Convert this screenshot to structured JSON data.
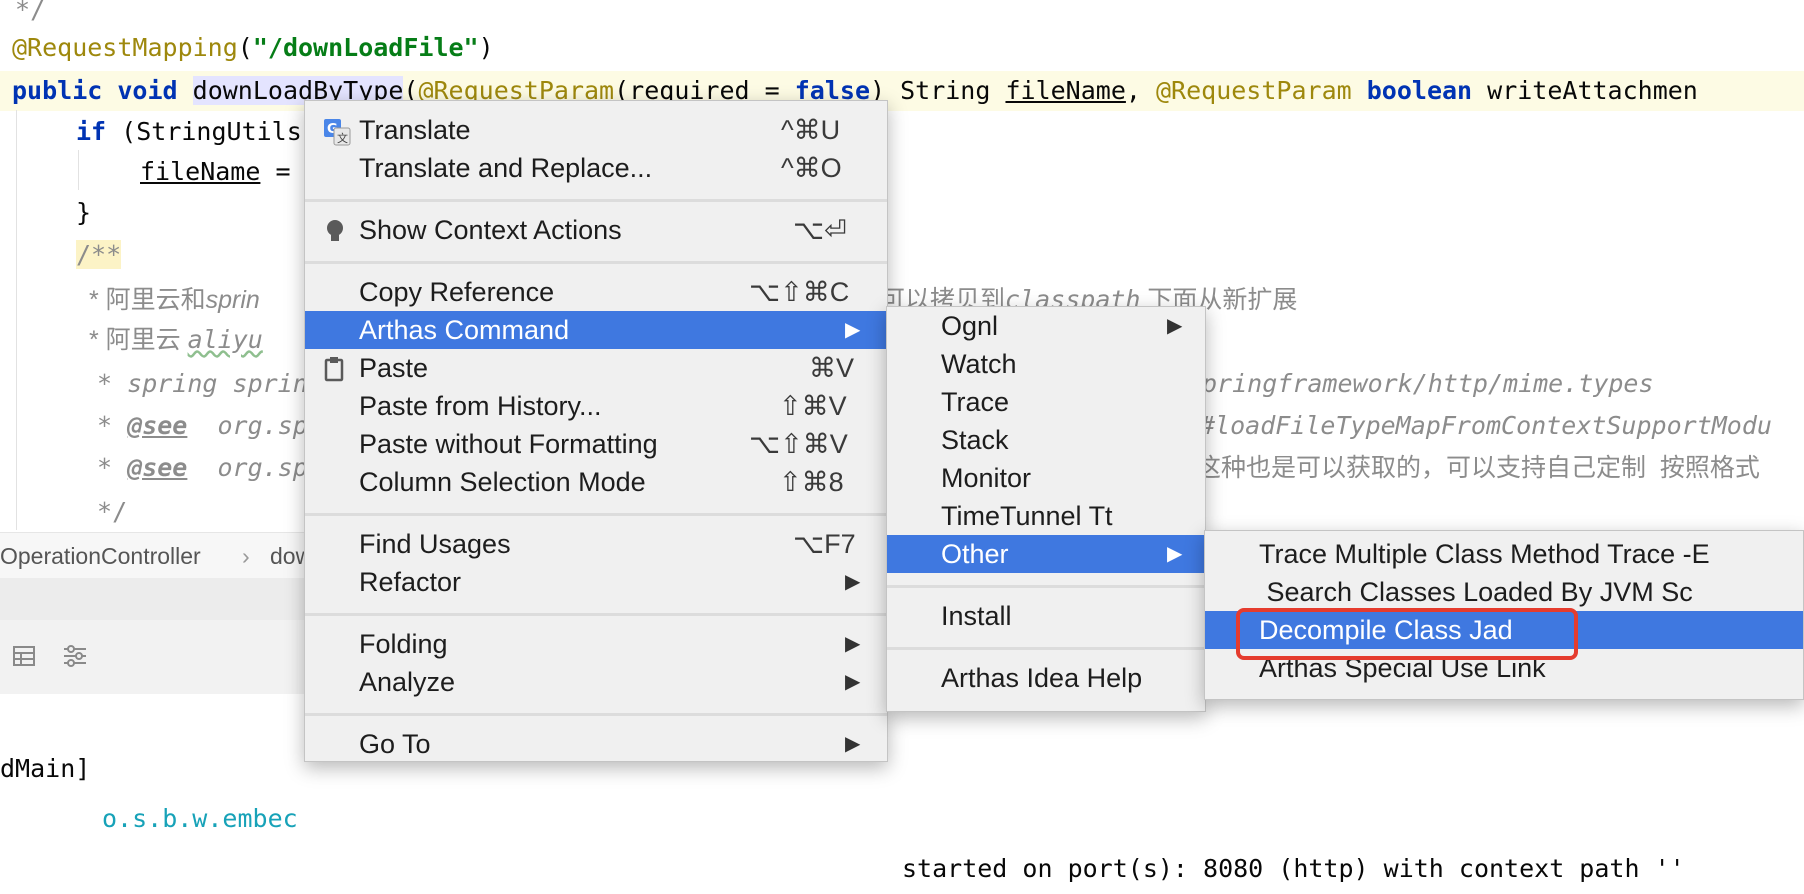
{
  "editor": {
    "line_comment_end": " */",
    "annotation_mapping": "@RequestMapping",
    "mapping_path": "\"/downLoadFile\"",
    "method_kw_public": "public",
    "method_kw_void": "void",
    "method_name": "downLoadByType",
    "param_annotation_1": "@RequestParam",
    "param_required": "(required = ",
    "kw_false": "false",
    "param_close": ") String ",
    "param_filename": "fileName",
    "param_comma": ", ",
    "param_annotation_2": "@RequestParam",
    "kw_boolean": "boolean",
    "param_write": " writeAttachmen",
    "if_kw": "if",
    "if_rest": " (StringUtils",
    "assign_var": "fileName",
    "assign_rest": " =",
    "close_brace": "}",
    "doc_start": "/**",
    "doc_line1_a": " * 阿里云和",
    "doc_line1_b": "sprin",
    "doc_line1_c": "可以拷贝到",
    "doc_line1_d": "classpath",
    "doc_line1_e": " 下面从新扩展",
    "doc_line2_a": " * 阿里云 ",
    "doc_line2_b": "aliyu",
    "doc_line3_a": " * spring sprin",
    "doc_line3_b": "pringframework/http/mime.types",
    "doc_line4_star": " * ",
    "doc_line4_tag": "@see",
    "doc_line4_b": "  org.sp",
    "doc_line4_c": "#loadFileTypeMapFromContextSupportModu",
    "doc_line5_star": " * ",
    "doc_line5_tag": "@see",
    "doc_line5_b": "  org.sp",
    "doc_line5_c": "这种也是可以获取的，可以支持自己定制  按照格式",
    "doc_end": " */"
  },
  "breadcrumb": {
    "class_name": "OperationController",
    "separator": "›",
    "method_partial": "dow"
  },
  "console": {
    "thread": "dMain]",
    "logger": "o.s.b.w.embec",
    "message": "started on port(s): 8080 (http) with context path ''"
  },
  "context_menu": {
    "items": [
      {
        "label": "Translate",
        "shortcut": "^⌘U",
        "icon": "google-translate-icon"
      },
      {
        "label": "Translate and Replace...",
        "shortcut": "^⌘O"
      },
      {
        "label": "Show Context Actions",
        "shortcut": "⌥⏎",
        "icon": "lightbulb-icon"
      },
      {
        "label": "Copy Reference",
        "shortcut": "⌥⇧⌘C"
      },
      {
        "label": "Arthas Command",
        "submenu": true,
        "active": true
      },
      {
        "label": "Paste",
        "shortcut": "⌘V",
        "icon": "clipboard-icon"
      },
      {
        "label": "Paste from History...",
        "shortcut": "⇧⌘V"
      },
      {
        "label": "Paste without Formatting",
        "shortcut": "⌥⇧⌘V"
      },
      {
        "label": "Column Selection Mode",
        "shortcut": "⇧⌘8"
      },
      {
        "label": "Find Usages",
        "shortcut": "⌥F7"
      },
      {
        "label": "Refactor",
        "submenu": true
      },
      {
        "label": "Folding",
        "submenu": true
      },
      {
        "label": "Analyze",
        "submenu": true
      },
      {
        "label": "Go To",
        "submenu": true
      }
    ]
  },
  "arthas_menu": {
    "items": [
      {
        "label": "Ognl",
        "submenu": true
      },
      {
        "label": "Watch"
      },
      {
        "label": "Trace"
      },
      {
        "label": "Stack"
      },
      {
        "label": "Monitor"
      },
      {
        "label": "TimeTunnel Tt"
      },
      {
        "label": "Other",
        "submenu": true,
        "active": true
      },
      {
        "label": "Install"
      },
      {
        "label": "Arthas Idea Help"
      }
    ]
  },
  "other_menu": {
    "items": [
      {
        "label": "Trace Multiple Class Method Trace -E"
      },
      {
        "label": " Search Classes Loaded By JVM Sc"
      },
      {
        "label": "Decompile Class Jad",
        "active": true,
        "highlighted_box": true
      },
      {
        "label": "Arthas Special Use Link"
      }
    ]
  },
  "colors": {
    "menu_highlight": "#3f78e0",
    "annotation_box": "#e53c2e",
    "menu_background": "#f0f0f0"
  }
}
